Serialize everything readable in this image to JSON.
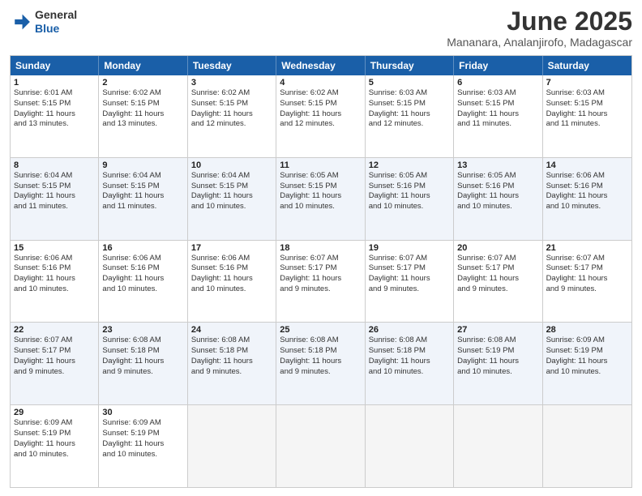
{
  "logo": {
    "text_general": "General",
    "text_blue": "Blue"
  },
  "title": "June 2025",
  "subtitle": "Mananara, Analanjirofo, Madagascar",
  "header_days": [
    "Sunday",
    "Monday",
    "Tuesday",
    "Wednesday",
    "Thursday",
    "Friday",
    "Saturday"
  ],
  "rows": [
    {
      "alt": false,
      "cells": [
        {
          "day": "1",
          "lines": [
            "Sunrise: 6:01 AM",
            "Sunset: 5:15 PM",
            "Daylight: 11 hours",
            "and 13 minutes."
          ]
        },
        {
          "day": "2",
          "lines": [
            "Sunrise: 6:02 AM",
            "Sunset: 5:15 PM",
            "Daylight: 11 hours",
            "and 13 minutes."
          ]
        },
        {
          "day": "3",
          "lines": [
            "Sunrise: 6:02 AM",
            "Sunset: 5:15 PM",
            "Daylight: 11 hours",
            "and 12 minutes."
          ]
        },
        {
          "day": "4",
          "lines": [
            "Sunrise: 6:02 AM",
            "Sunset: 5:15 PM",
            "Daylight: 11 hours",
            "and 12 minutes."
          ]
        },
        {
          "day": "5",
          "lines": [
            "Sunrise: 6:03 AM",
            "Sunset: 5:15 PM",
            "Daylight: 11 hours",
            "and 12 minutes."
          ]
        },
        {
          "day": "6",
          "lines": [
            "Sunrise: 6:03 AM",
            "Sunset: 5:15 PM",
            "Daylight: 11 hours",
            "and 11 minutes."
          ]
        },
        {
          "day": "7",
          "lines": [
            "Sunrise: 6:03 AM",
            "Sunset: 5:15 PM",
            "Daylight: 11 hours",
            "and 11 minutes."
          ]
        }
      ]
    },
    {
      "alt": true,
      "cells": [
        {
          "day": "8",
          "lines": [
            "Sunrise: 6:04 AM",
            "Sunset: 5:15 PM",
            "Daylight: 11 hours",
            "and 11 minutes."
          ]
        },
        {
          "day": "9",
          "lines": [
            "Sunrise: 6:04 AM",
            "Sunset: 5:15 PM",
            "Daylight: 11 hours",
            "and 11 minutes."
          ]
        },
        {
          "day": "10",
          "lines": [
            "Sunrise: 6:04 AM",
            "Sunset: 5:15 PM",
            "Daylight: 11 hours",
            "and 10 minutes."
          ]
        },
        {
          "day": "11",
          "lines": [
            "Sunrise: 6:05 AM",
            "Sunset: 5:15 PM",
            "Daylight: 11 hours",
            "and 10 minutes."
          ]
        },
        {
          "day": "12",
          "lines": [
            "Sunrise: 6:05 AM",
            "Sunset: 5:16 PM",
            "Daylight: 11 hours",
            "and 10 minutes."
          ]
        },
        {
          "day": "13",
          "lines": [
            "Sunrise: 6:05 AM",
            "Sunset: 5:16 PM",
            "Daylight: 11 hours",
            "and 10 minutes."
          ]
        },
        {
          "day": "14",
          "lines": [
            "Sunrise: 6:06 AM",
            "Sunset: 5:16 PM",
            "Daylight: 11 hours",
            "and 10 minutes."
          ]
        }
      ]
    },
    {
      "alt": false,
      "cells": [
        {
          "day": "15",
          "lines": [
            "Sunrise: 6:06 AM",
            "Sunset: 5:16 PM",
            "Daylight: 11 hours",
            "and 10 minutes."
          ]
        },
        {
          "day": "16",
          "lines": [
            "Sunrise: 6:06 AM",
            "Sunset: 5:16 PM",
            "Daylight: 11 hours",
            "and 10 minutes."
          ]
        },
        {
          "day": "17",
          "lines": [
            "Sunrise: 6:06 AM",
            "Sunset: 5:16 PM",
            "Daylight: 11 hours",
            "and 10 minutes."
          ]
        },
        {
          "day": "18",
          "lines": [
            "Sunrise: 6:07 AM",
            "Sunset: 5:17 PM",
            "Daylight: 11 hours",
            "and 9 minutes."
          ]
        },
        {
          "day": "19",
          "lines": [
            "Sunrise: 6:07 AM",
            "Sunset: 5:17 PM",
            "Daylight: 11 hours",
            "and 9 minutes."
          ]
        },
        {
          "day": "20",
          "lines": [
            "Sunrise: 6:07 AM",
            "Sunset: 5:17 PM",
            "Daylight: 11 hours",
            "and 9 minutes."
          ]
        },
        {
          "day": "21",
          "lines": [
            "Sunrise: 6:07 AM",
            "Sunset: 5:17 PM",
            "Daylight: 11 hours",
            "and 9 minutes."
          ]
        }
      ]
    },
    {
      "alt": true,
      "cells": [
        {
          "day": "22",
          "lines": [
            "Sunrise: 6:07 AM",
            "Sunset: 5:17 PM",
            "Daylight: 11 hours",
            "and 9 minutes."
          ]
        },
        {
          "day": "23",
          "lines": [
            "Sunrise: 6:08 AM",
            "Sunset: 5:18 PM",
            "Daylight: 11 hours",
            "and 9 minutes."
          ]
        },
        {
          "day": "24",
          "lines": [
            "Sunrise: 6:08 AM",
            "Sunset: 5:18 PM",
            "Daylight: 11 hours",
            "and 9 minutes."
          ]
        },
        {
          "day": "25",
          "lines": [
            "Sunrise: 6:08 AM",
            "Sunset: 5:18 PM",
            "Daylight: 11 hours",
            "and 9 minutes."
          ]
        },
        {
          "day": "26",
          "lines": [
            "Sunrise: 6:08 AM",
            "Sunset: 5:18 PM",
            "Daylight: 11 hours",
            "and 10 minutes."
          ]
        },
        {
          "day": "27",
          "lines": [
            "Sunrise: 6:08 AM",
            "Sunset: 5:19 PM",
            "Daylight: 11 hours",
            "and 10 minutes."
          ]
        },
        {
          "day": "28",
          "lines": [
            "Sunrise: 6:09 AM",
            "Sunset: 5:19 PM",
            "Daylight: 11 hours",
            "and 10 minutes."
          ]
        }
      ]
    },
    {
      "alt": false,
      "cells": [
        {
          "day": "29",
          "lines": [
            "Sunrise: 6:09 AM",
            "Sunset: 5:19 PM",
            "Daylight: 11 hours",
            "and 10 minutes."
          ]
        },
        {
          "day": "30",
          "lines": [
            "Sunrise: 6:09 AM",
            "Sunset: 5:19 PM",
            "Daylight: 11 hours",
            "and 10 minutes."
          ]
        },
        {
          "day": "",
          "lines": [],
          "empty": true
        },
        {
          "day": "",
          "lines": [],
          "empty": true
        },
        {
          "day": "",
          "lines": [],
          "empty": true
        },
        {
          "day": "",
          "lines": [],
          "empty": true
        },
        {
          "day": "",
          "lines": [],
          "empty": true
        }
      ]
    }
  ]
}
